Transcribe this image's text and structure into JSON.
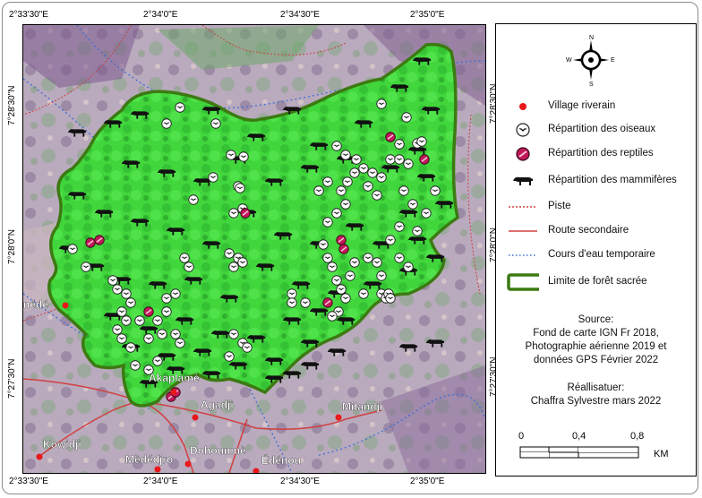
{
  "coordinates": {
    "top": [
      "2°33'30\"E",
      "2°34'0\"E",
      "2°34'30\"E",
      "2°35'0\"E"
    ],
    "bottom": [
      "2°33'30\"E",
      "2°34'0\"E",
      "2°34'30\"E",
      "2°35'0\"E"
    ],
    "left": [
      "7°28'30\"N",
      "7°28'0\"N",
      "7°27'30\"N"
    ],
    "right": [
      "7°28'30\"N",
      "7°28'0\"N",
      "7°27'30\"N"
    ]
  },
  "places": [
    "nédé",
    "Akaplamè",
    "Agadji",
    "Mitandji",
    "Kowidji",
    "Mèdédjro",
    "Dohounmè",
    "Édénou"
  ],
  "legend": {
    "compass": {
      "n": "N",
      "s": "S",
      "e": "E",
      "w": "W"
    },
    "items": [
      {
        "symbol": "village",
        "label": "Village riverain"
      },
      {
        "symbol": "bird",
        "label": "Répartition des oiseaux"
      },
      {
        "symbol": "reptile",
        "label": "Répartition des reptiles"
      },
      {
        "symbol": "mammal",
        "label": "Répartition des mammifères"
      },
      {
        "symbol": "track",
        "label": "Piste"
      },
      {
        "symbol": "road",
        "label": "Route secondaire"
      },
      {
        "symbol": "stream",
        "label": "Cours d'eau temporaire"
      },
      {
        "symbol": "forest-limit",
        "label": "Limite de forêt sacrée"
      }
    ],
    "source_title": "Source:",
    "source_lines": [
      "Fond de carte IGN Fr 2018,",
      "Photographie aérienne 2019 et",
      "données GPS Février 2022"
    ],
    "author_title": "Réallisatuer:",
    "author_line": "Chaffra Sylvestre mars 2022",
    "scale": {
      "ticks": [
        "0",
        "0,4",
        "0,8"
      ],
      "unit": "KM"
    }
  },
  "colors": {
    "forest": "#3ed63a",
    "forest_dark": "#1f9a25",
    "boundary": "#3c7a12",
    "village": "#e8181b",
    "reptile": "#c2185b",
    "road": "#d04040",
    "stream": "#3a6fd8",
    "background": "#b8a8b8"
  }
}
